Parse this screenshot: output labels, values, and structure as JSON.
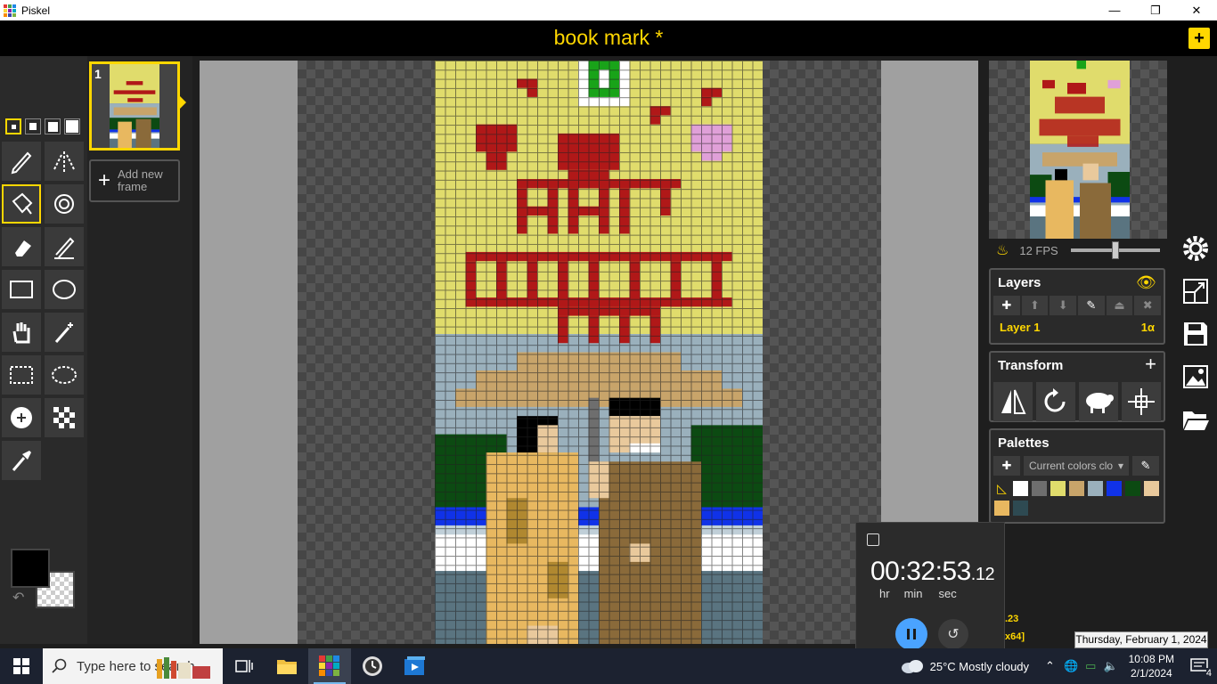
{
  "window": {
    "app_name": "Piskel",
    "minimize": "—",
    "restore": "❐",
    "close": "✕"
  },
  "header": {
    "doc_title": "book mark *",
    "new_label": "+"
  },
  "frames": {
    "frame_number": "1",
    "add_frame_label": "Add new frame"
  },
  "preview": {
    "fps_label": "12 FPS",
    "fps_value": 12
  },
  "layers": {
    "title": "Layers",
    "layer_name": "Layer 1",
    "opacity": "1α"
  },
  "transform": {
    "title": "Transform"
  },
  "palettes": {
    "title": "Palettes",
    "selected": "Current colors clo",
    "colors": [
      "#ffffff",
      "#6e6e6e",
      "#e0dc6c",
      "#c8a46a",
      "#9ab0bc",
      "#1032e8",
      "#0c4a12",
      "#e9c99c",
      "#e8b860",
      "#2e4a52"
    ]
  },
  "colors": {
    "primary": "#000000",
    "accent": "#ffd700"
  },
  "timer": {
    "main": "00:32:53",
    "fraction": ".12",
    "unit_hr": "hr",
    "unit_min": "min",
    "unit_sec": "sec"
  },
  "peek": {
    "fps_tail": ".23",
    "size_tail": "x64]"
  },
  "tooltip": {
    "date_long": "Thursday, February 1, 2024"
  },
  "taskbar": {
    "search_placeholder": "Type here to search",
    "weather": "25°C  Mostly cloudy",
    "time": "10:08 PM",
    "date": "2/1/2024",
    "notification_count": "4"
  }
}
